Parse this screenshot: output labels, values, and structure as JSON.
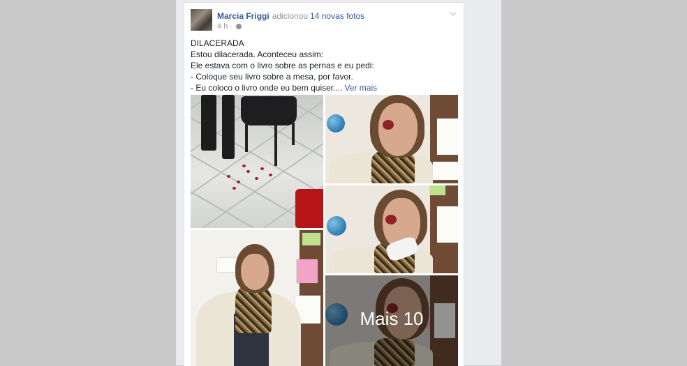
{
  "post": {
    "author": "Marcia Friggi",
    "action": "adicionou",
    "photos_link": "14 novas fotos",
    "timestamp": "4 h",
    "audience_icon": "globe-icon",
    "text_lines": [
      "DILACERADA",
      "Estou dilacerada. Aconteceu assim:",
      "Ele estava com o livro sobre as pernas e eu pedi:",
      "- Coloque seu livro sobre a mesa, por favor.",
      "- Eu coloco o livro onde eu bem quiser...."
    ],
    "see_more": "Ver mais"
  },
  "photos": {
    "more_label": "Mais 10"
  },
  "colors": {
    "link": "#365899",
    "meta": "#90949c",
    "text": "#1d2129",
    "page_bg": "#c9c9c9"
  }
}
